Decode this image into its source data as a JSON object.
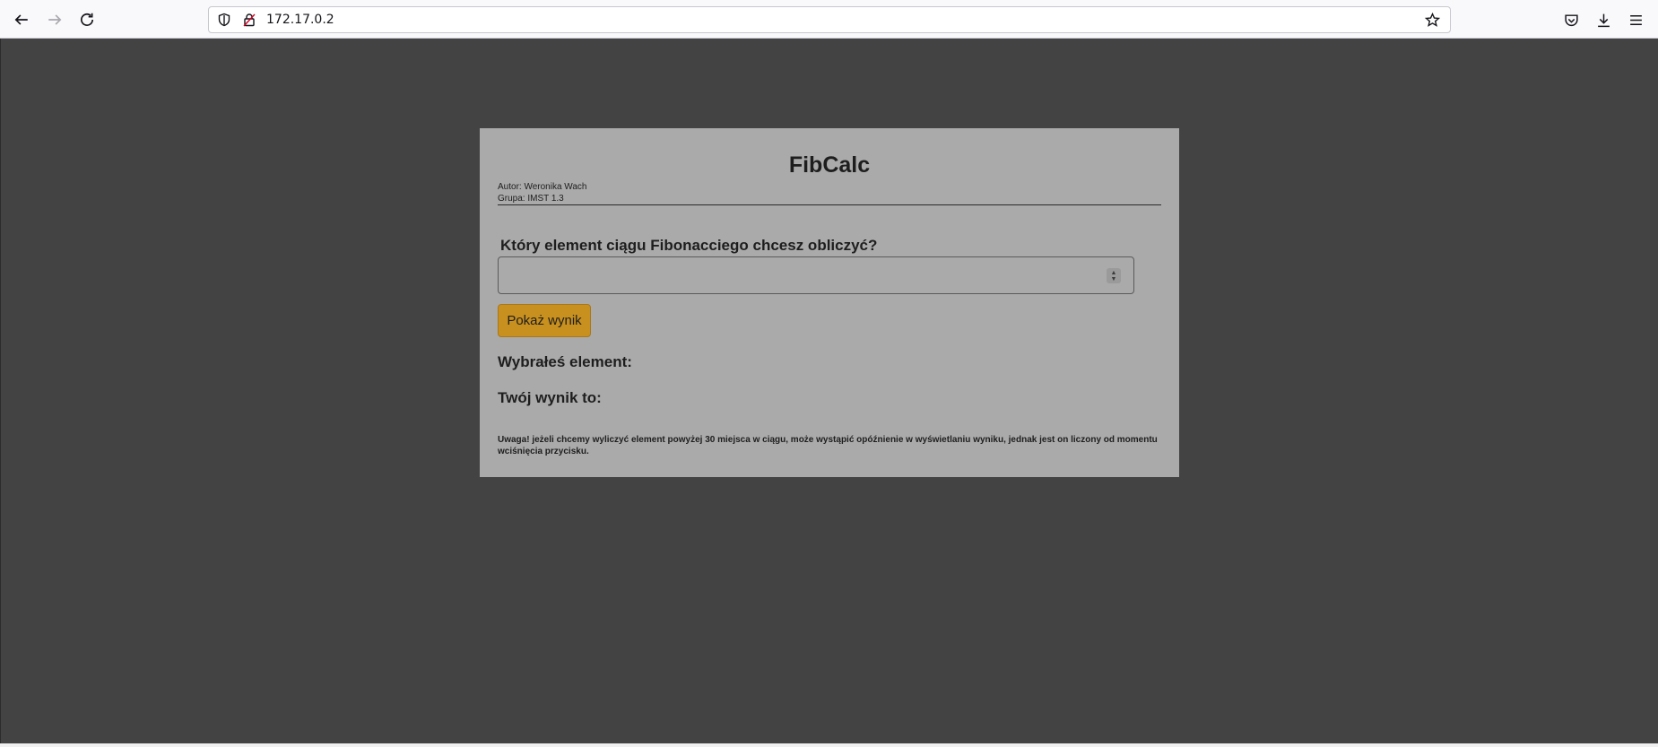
{
  "browser": {
    "url": "172.17.0.2"
  },
  "page": {
    "title": "FibCalc",
    "author_line": "Autor: Weronika Wach",
    "group_line": "Grupa: IMST 1.3",
    "question": "Który element ciągu Fibonacciego chcesz obliczyć?",
    "input_value": "",
    "button_label": "Pokaż wynik",
    "chosen_label": "Wybrałeś element:",
    "result_label": "Twój wynik to:",
    "note": "Uwaga! jeżeli chcemy wyliczyć element powyżej 30 miejsca w ciągu, może wystąpić opóźnienie w wyświetlaniu wyniku, jednak jest on liczony od momentu wciśnięcia przycisku."
  },
  "colors": {
    "background": "#434343",
    "card": "#aaaaaa",
    "button": "#c8901e"
  },
  "icons": {
    "back": "arrow-left-icon",
    "forward": "arrow-right-icon",
    "reload": "reload-icon",
    "tracking": "shield-icon",
    "insecure": "lock-warning-icon",
    "bookmark": "star-icon",
    "pocket": "pocket-icon",
    "downloads": "download-icon",
    "menu": "hamburger-menu-icon"
  }
}
